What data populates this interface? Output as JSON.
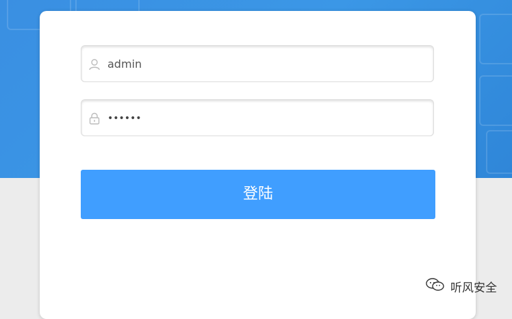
{
  "login": {
    "username_value": "admin",
    "password_value": "••••••",
    "submit_label": "登陆"
  },
  "watermark": {
    "text": "听风安全",
    "icon": "wechat-icon"
  },
  "colors": {
    "background_top": "#3a8fe2",
    "background_bottom": "#ececec",
    "button": "#409eff"
  },
  "icons": {
    "username": "user-icon",
    "password": "lock-icon"
  }
}
